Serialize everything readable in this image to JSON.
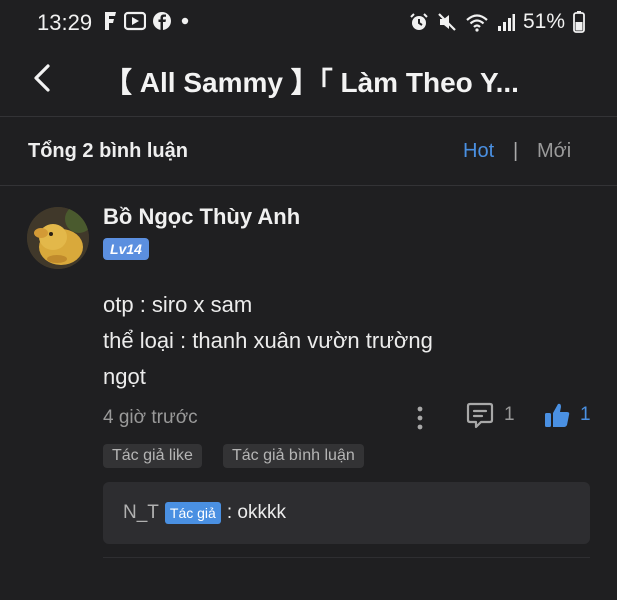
{
  "status_bar": {
    "time": "13:29",
    "battery": "51%",
    "left_icons": [
      "facebook-f-icon",
      "video-play-icon",
      "facebook-circle-icon",
      "dot-icon"
    ],
    "right_icons": [
      "alarm-icon",
      "mute-icon",
      "wifi-icon",
      "signal-icon",
      "battery-icon"
    ]
  },
  "header": {
    "title": "【 All Sammy 】「 Làm Theo Y..."
  },
  "comments_bar": {
    "total_label": "Tổng 2 bình luận",
    "sort_hot": "Hot",
    "separator": "|",
    "sort_new": "Mới",
    "accent_color": "#4a90e2"
  },
  "comment": {
    "username": "Bồ Ngọc Thùy Anh",
    "level": "Lv14",
    "lines": [
      "otp : siro x sam",
      "thể loại : thanh xuân vườn trường",
      "ngọt"
    ],
    "timestamp": "4 giờ trước",
    "reply_count": "1",
    "like_count": "1",
    "tags": [
      "Tác giả like",
      "Tác giả bình luận"
    ],
    "reply": {
      "author": "N_T",
      "badge": "Tác giả",
      "text": ": okkkk"
    }
  }
}
